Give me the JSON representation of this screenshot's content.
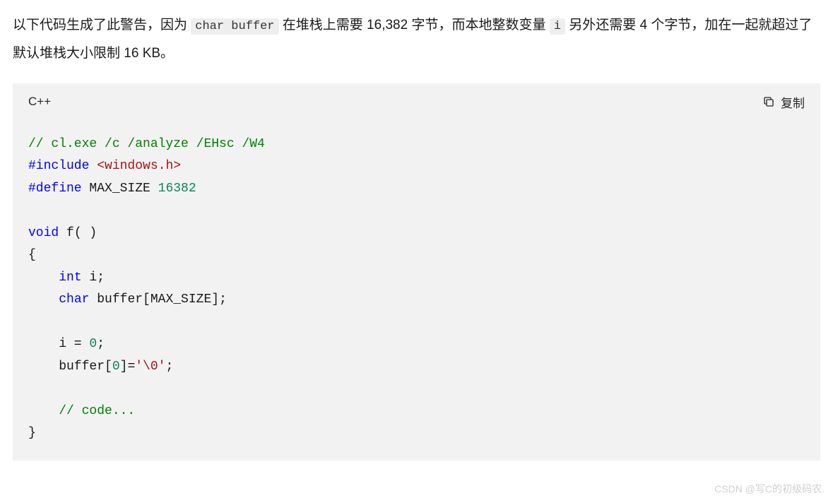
{
  "paragraph": {
    "seg1": "以下代码生成了此警告，因为 ",
    "code1": "char buffer",
    "seg2": " 在堆栈上需要 16,382 字节，而本地整数变量 ",
    "code2": "i",
    "seg3": " 另外还需要 4 个字节，加在一起就超过了默认堆栈大小限制 16 KB。"
  },
  "codeblock": {
    "language": "C++",
    "copy_label": "复制",
    "lines": {
      "l1_comment": "// cl.exe /c /analyze /EHsc /W4",
      "l2_pp": "#include",
      "l2_inc": " <windows.h>",
      "l3_pp": "#define",
      "l3_macro": " MAX_SIZE ",
      "l3_num": "16382",
      "l4_kw": "void",
      "l4_fn": " f( )",
      "l5_brace": "{",
      "l6_type": "int",
      "l6_rest": " i;",
      "l7_type": "char",
      "l7_rest": " buffer[MAX_SIZE];",
      "l8": "    i = ",
      "l8_num": "0",
      "l8_semi": ";",
      "l9_a": "    buffer[",
      "l9_num": "0",
      "l9_b": "]=",
      "l9_str": "'\\0'",
      "l9_semi": ";",
      "l10_comment": "// code...",
      "l11_brace": "}"
    }
  },
  "watermark": "CSDN @写C的初级码农."
}
